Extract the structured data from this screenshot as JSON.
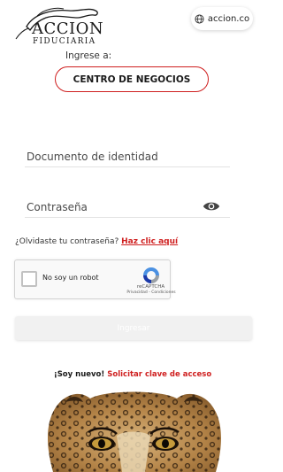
{
  "logo": {
    "brand": "ACCION",
    "sub": "FIDUCIARIA"
  },
  "domain_pill": {
    "icon": "globe-icon",
    "label": "accion.co"
  },
  "login": {
    "enter_label": "Ingrese a:",
    "business_button": "CENTRO DE NEGOCIOS",
    "document_placeholder": "Documento de identidad",
    "password_placeholder": "Contraseña",
    "forgot_text": "¿Olvidaste tu contraseña?",
    "forgot_link": "Haz clic aquí",
    "submit_label": "Ingresar"
  },
  "captcha": {
    "label": "No soy un robot",
    "brand": "reCAPTCHA",
    "links": "Privacidad - Condiciones"
  },
  "signup": {
    "text": "¡Soy nuevo!",
    "link": "Solicitar clave de acceso"
  },
  "colors": {
    "accent": "#cf1f1f"
  }
}
